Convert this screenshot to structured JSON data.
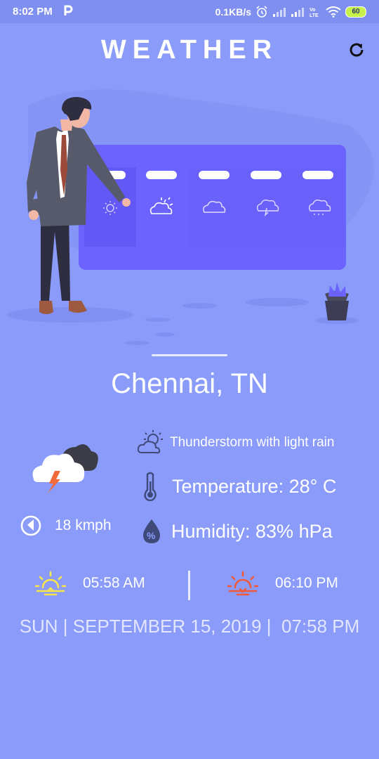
{
  "status_bar": {
    "time": "8:02 PM",
    "speed": "0.1KB/s",
    "battery": "60",
    "icons": [
      "p-icon",
      "alarm-icon",
      "signal-icon",
      "signal-icon",
      "volte-icon",
      "wifi-icon",
      "battery-icon"
    ]
  },
  "header": {
    "title": "WEATHER",
    "refresh_icon": "refresh-icon"
  },
  "weather": {
    "city": "Chennai, TN",
    "condition": "Thunderstorm with light rain",
    "temperature": "Temperature: 28° C",
    "humidity": "Humidity: 83% hPa",
    "wind": "18 kmph",
    "sunrise": "05:58 AM",
    "sunset": "06:10 PM",
    "date_line": "SUN | SEPTEMBER 15, 2019 |  07:58 PM"
  },
  "colors": {
    "background": "#8a9bfa",
    "card": "#6c63ff",
    "sunrise": "#f7e54a",
    "sunset": "#f05a3a"
  }
}
